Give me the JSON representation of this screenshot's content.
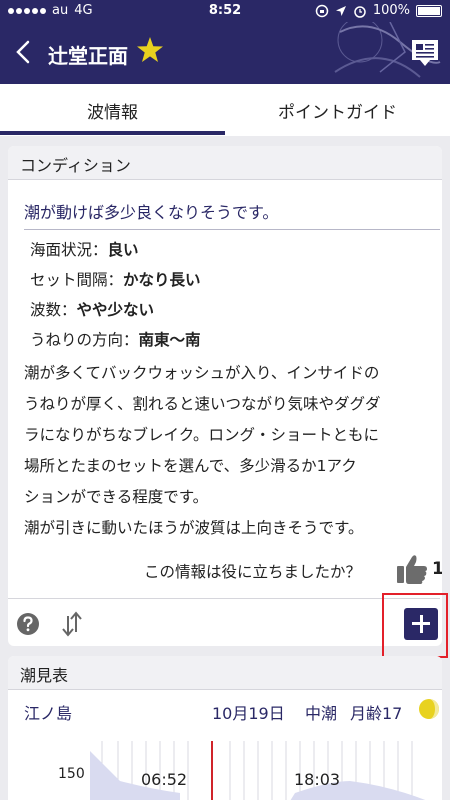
{
  "status": {
    "carrier": "au",
    "network": "4G",
    "time": "8:52",
    "battery": "100%"
  },
  "nav": {
    "title": "辻堂正面",
    "favorite_icon": "star-icon",
    "star_color": "#e8d21f",
    "accent": "#2a2866"
  },
  "tabs": [
    {
      "label": "波情報",
      "active": true
    },
    {
      "label": "ポイントガイド",
      "active": false
    }
  ],
  "condition": {
    "header": "コンディション",
    "summary": "潮が動けば多少良くなりそうです。",
    "items": [
      {
        "label": "海面状況：",
        "value": "良い"
      },
      {
        "label": "セット間隔：",
        "value": "かなり長い"
      },
      {
        "label": "波数：",
        "value": "やや少ない"
      },
      {
        "label": "うねりの方向：",
        "value": "南東〜南"
      }
    ],
    "description_lines": [
      "潮が多くてバックウォッシュが入り、インサイドの",
      "うねりが厚く、割れると速いつながり気味やダグダ",
      "ラになりがちなブレイク。ロング・ショートともに",
      "場所とたまのセットを選んで、多少滑るか1アク",
      "ションができる程度です。"
    ],
    "description2": "潮が引きに動いたほうが波質は上向きそうです。",
    "helpful_question": "この情報は役に立ちましたか？",
    "helpful_count": "1"
  },
  "tide": {
    "header": "潮見表",
    "location": "江ノ島",
    "date": "10月19日",
    "tide_type": "中潮",
    "moon_age": "月齢17",
    "y_label": "150",
    "times": [
      "06:52",
      "18:03"
    ]
  }
}
